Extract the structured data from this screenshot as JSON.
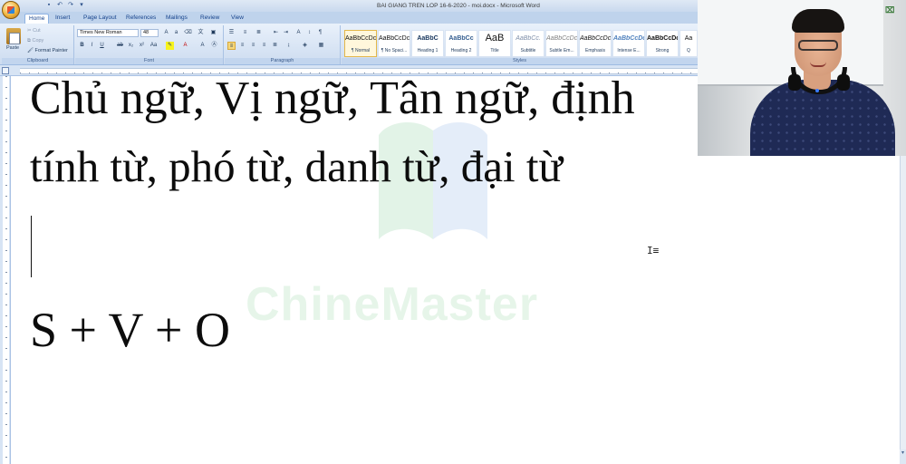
{
  "window": {
    "title": "BAI GIANG TREN LOP 16-6-2020 - moi.docx - Microsoft Word"
  },
  "tabs": [
    {
      "label": "Home",
      "active": true
    },
    {
      "label": "Insert"
    },
    {
      "label": "Page Layout"
    },
    {
      "label": "References"
    },
    {
      "label": "Mailings"
    },
    {
      "label": "Review"
    },
    {
      "label": "View"
    }
  ],
  "ribbon": {
    "clipboard": {
      "label": "Clipboard",
      "paste": "Paste",
      "cut": "Cut",
      "copy": "Copy",
      "format_painter": "Format Painter"
    },
    "font": {
      "label": "Font",
      "font_name": "Times New Roman",
      "font_size": "48"
    },
    "paragraph": {
      "label": "Paragraph"
    },
    "styles": {
      "label": "Styles",
      "items": [
        {
          "sample": "AaBbCcDc",
          "name": "¶ Normal",
          "selected": true
        },
        {
          "sample": "AaBbCcDc",
          "name": "¶ No Spaci..."
        },
        {
          "sample": "AaBbC",
          "name": "Heading 1"
        },
        {
          "sample": "AaBbCc",
          "name": "Heading 2"
        },
        {
          "sample": "AaB",
          "name": "Title"
        },
        {
          "sample": "AaBbCc.",
          "name": "Subtitle"
        },
        {
          "sample": "AaBbCcDc",
          "name": "Subtle Em..."
        },
        {
          "sample": "AaBbCcDc",
          "name": "Emphasis"
        },
        {
          "sample": "AaBbCcDc",
          "name": "Intense E..."
        },
        {
          "sample": "AaBbCcDc",
          "name": "Strong"
        },
        {
          "sample": "Aa",
          "name": "Q"
        }
      ]
    }
  },
  "document": {
    "line1": "Chủ ngữ, Vị ngữ, Tân ngữ, định",
    "line2": "tính từ, phó từ, danh từ, đại từ",
    "line3": "S + V + O"
  },
  "watermark": {
    "text": "ChineMaster"
  }
}
